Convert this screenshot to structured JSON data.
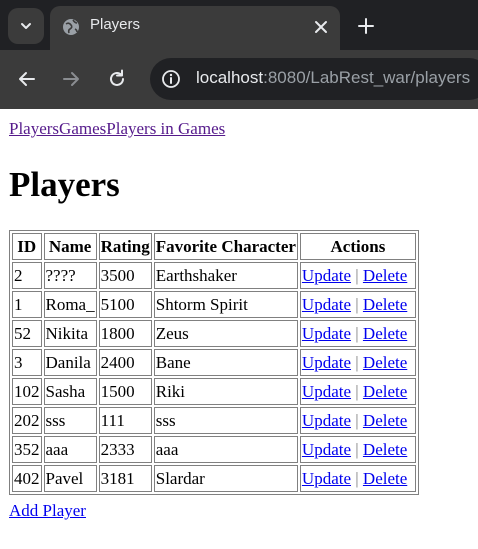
{
  "browser": {
    "tab_title": "Players",
    "url_host": "localhost",
    "url_rest": ":8080/LabRest_war/players"
  },
  "nav": {
    "players": "Players",
    "games": "Games",
    "players_in_games": "Players in Games"
  },
  "page_title": "Players",
  "table": {
    "headers": [
      "ID",
      "Name",
      "Rating",
      "Favorite Character",
      "Actions"
    ],
    "rows": [
      {
        "id": "2",
        "name": "????",
        "rating": "3500",
        "character": "Earthshaker"
      },
      {
        "id": "1",
        "name": "Roma_",
        "rating": "5100",
        "character": "Shtorm Spirit"
      },
      {
        "id": "52",
        "name": "Nikita",
        "rating": "1800",
        "character": "Zeus"
      },
      {
        "id": "3",
        "name": "Danila",
        "rating": "2400",
        "character": "Bane"
      },
      {
        "id": "102",
        "name": "Sasha",
        "rating": "1500",
        "character": "Riki"
      },
      {
        "id": "202",
        "name": "sss",
        "rating": "111",
        "character": "sss"
      },
      {
        "id": "352",
        "name": "aaa",
        "rating": "2333",
        "character": "aaa"
      },
      {
        "id": "402",
        "name": "Pavel",
        "rating": "3181",
        "character": "Slardar"
      }
    ],
    "update_label": "Update",
    "separator": "|",
    "delete_label": "Delete"
  },
  "add_player_label": "Add Player",
  "colors": {
    "visited_link": "#551a8b",
    "link": "#0000ee",
    "chrome_dark": "#202124",
    "chrome_toolbar": "#3b3b3b"
  }
}
